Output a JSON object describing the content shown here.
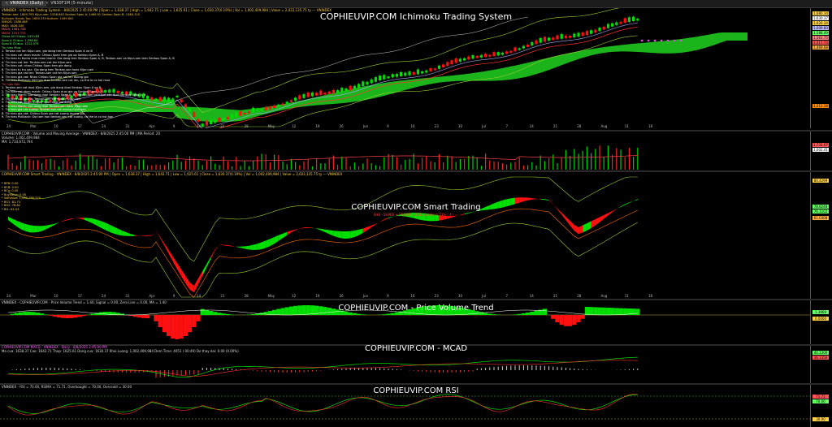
{
  "tabs": [
    {
      "label": "VNINDEX (Daily)",
      "active": true
    },
    {
      "label": "VN30F1M (5-minute)",
      "active": false
    }
  ],
  "dates": [
    "24",
    "Mar",
    "10",
    "17",
    "24",
    "31",
    "Apr",
    "9",
    "14",
    "21",
    "28",
    "May",
    "12",
    "19",
    "26",
    "Jun",
    "9",
    "16",
    "23",
    "30",
    "Jul",
    "7",
    "14",
    "21",
    "28",
    "Aug",
    "11",
    "18"
  ],
  "ichimoku": {
    "title": "COPHIEUVIP.COM Ichimoku Trading System",
    "header": "VNINDEX - Ichimoku Trading System - 8/8/2025 2:45:00 PM | Open = 1,638.37 | High = 1,642.71 | Low = 1,625.61 | Close = 1,630.37(0.19%) | Vol = 1,002,409,984 | Value = 2,022,135.75 ty --- VNINDEX",
    "info": [
      {
        "text": "Tenkan-sen: 1609.795  Kijun-sen: 1558.645  Senkou Span A: 1466.91  Senkou Span B: 1348.115",
        "color": "#ffd24a"
      },
      {
        "text": "Bollinger Bands Top: 1680.339  Bottom: 1469.681",
        "color": "#ffb040"
      },
      {
        "text": "SMA20: 1588.485",
        "color": "#ffd24a"
      },
      {
        "text": "MA5: 1626.335",
        "color": "#ffd24a"
      },
      {
        "text": "MA20: 1561.748",
        "color": "#ff8888"
      },
      {
        "text": "MA50: 1517.725",
        "color": "#ff6666"
      },
      {
        "text": "Cloud All Chikou: 1470.83",
        "color": "#66ff66"
      },
      {
        "text": "Span A Chikou: 1,398.64",
        "color": "#66ff66"
      },
      {
        "text": "Span B Chikou: 1212.375",
        "color": "#66ff66"
      },
      {
        "text": "Tin hieu Mua:",
        "color": "#66ff66"
      },
      {
        "text": "1. Tenkan cat len Kijun-sen, gia dong tren Senkou Span A va B",
        "color": "#ffffff"
      },
      {
        "text": "2. Tin hieu cat nhan manh: Chikou Span tren gia va Senkou Span A, B",
        "color": "#ffffff"
      },
      {
        "text": "3. Tin hieu tu Kumo mua nhan thanh: Gia dong tren Senkou Span A, B, Tenkan-sen va Kijun-sen tren Senkou Span A, B",
        "color": "#ffffff"
      },
      {
        "text": "4. Tin hieu cat len: Tenkan-sen cat len Kijun-sen",
        "color": "#ffffff"
      },
      {
        "text": "5. Tin hieu cat: nhan Chikou Span tren gia dong",
        "color": "#ffffff"
      },
      {
        "text": "6. Tin hieu tu tru xac: Gia dong tren Tenkan-sen hoac Kijun-sen",
        "color": "#ffffff"
      },
      {
        "text": "7. Tin hieu gia cat len: Tenkan-sen cat len Kijun-sen",
        "color": "#ffffff"
      },
      {
        "text": "8. Tin hieu gia vat: Nhan Chikou Span gia cat len duong gia",
        "color": "#ffffff"
      },
      {
        "text": "9. Tin hieu Pullback: Ket hon duoi tenkan-sen cat len, co the la co hoi mua",
        "color": "#ffffff"
      },
      {
        "text": "Tin hieu Ban:",
        "color": "#ff5555"
      },
      {
        "text": "1. Tenkan-sen cat duoi Kijun-sen, gia dong duoi Senkou Span A va B",
        "color": "#ffffff"
      },
      {
        "text": "2. Tin hieu cat nhan manh: Chikou Span duoi gia va Senkou Span A, B",
        "color": "#ffffff"
      },
      {
        "text": "3. Tin hieu Manh: Gia dong duoi Senkou Span A, B, Tenkan-sen va Kijun-sen duoi Senkou Span A, B",
        "color": "#ffffff"
      },
      {
        "text": "4. Tin hieu cat xuong: Tenkan-sen cat xuong Kijun-sen",
        "color": "#ffffff"
      },
      {
        "text": "5. Tin hieu cat: nhan Chikou Span duoi gia dong",
        "color": "#ffffff"
      },
      {
        "text": "6. Tin hieu Manh: Gia dong duoi Tenkan-sen hoac Kijun-sen",
        "color": "#ffffff"
      },
      {
        "text": "7. Tin hieu gia cat xuong: Tenkan-sen cat xuong Kijun-sen",
        "color": "#ffffff"
      },
      {
        "text": "8. Tin hieu gia vat: Chikou Span gia cat xuong duong gia",
        "color": "#ffffff"
      },
      {
        "text": "9. Tin hieu Pullback: Gia tam hon tenkan-sen cat xuong, co the la co hoi ban",
        "color": "#ffffff"
      }
    ],
    "axis_tags": [
      {
        "value": "1,680.34",
        "color": "#ffd24a"
      },
      {
        "value": "1,630.37",
        "color": "#ffffff"
      },
      {
        "value": "1,626.34",
        "color": "#ffd24a"
      },
      {
        "value": "1,609.80",
        "color": "#bbbbff"
      },
      {
        "value": "1,588.49",
        "color": "#66ff66"
      },
      {
        "value": "1,561.75",
        "color": "#ff8888"
      },
      {
        "value": "1,517.73",
        "color": "#ff5555"
      },
      {
        "value": "1,469.68",
        "color": "#ffb040"
      },
      {
        "value": "1,212.38",
        "color": "#ff8c00"
      }
    ]
  },
  "volume": {
    "header": "COPHIEUVIP.COM - Volume and Moving Average - VNINDEX - 8/8/2025 2:45:00 PM | MA Period: 20",
    "line2": "Volume: 1,002,409,984",
    "line3": "MA: 1,733,672,794",
    "axis_tags": [
      {
        "value": "1,733.67",
        "color": "#ff5555"
      },
      {
        "value": "1,002.41",
        "color": "#ffffff"
      }
    ]
  },
  "smart": {
    "title": "COPHIEUVIP.COM Smart Trading",
    "subtitle": "SHB - SUPER + PROFIT = 1.11 points: 0.23% ( 4 ) ---",
    "header": "COPHIEUVIP.COM Smart Trading - VNINDEX - 8/8/2025 2:45:00 PM | Open = 1,638.37 | High = 1,642.71 | Low = 1,625.61 | Close = 1,630.37(0.19%) | Vol = 1,002,409,984 | Value = 2,022,135.75 ty --- VNINDEX",
    "info": [
      {
        "text": "* BPB:    0.00",
        "color": "#ffd24a"
      },
      {
        "text": "* BCB:    0.00",
        "color": "#ffd24a"
      },
      {
        "text": "* BCa:    0.00",
        "color": "#ffd24a"
      },
      {
        "text": "* BuyValue:    0.00",
        "color": "#ffd24a"
      },
      {
        "text": "* SellValue: 1,630,786,570",
        "color": "#ffd24a"
      },
      {
        "text": "* BO1:    81.73",
        "color": "#ffd24a"
      },
      {
        "text": "* BO2:    78.82",
        "color": "#ffd24a"
      },
      {
        "text": "* BI1:    61.03",
        "color": "#ffd24a"
      }
    ],
    "axis_tags": [
      {
        "value": "80.4299",
        "color": "#ffd24a"
      },
      {
        "value": "78.8248",
        "color": "#66ff66"
      },
      {
        "value": "76.1102",
        "color": "#66ff66"
      },
      {
        "value": "61.0308",
        "color": "#ffb040"
      }
    ]
  },
  "pvt": {
    "title": "COPHIEUVIP.COM - Price Volume Trend",
    "header": "VNINDEX - COPHIEUVIP.COM - Price Volume Trend = 1.40, Signal = 0.00, Zero Line = 0.00, MA = 1.40",
    "axis_tags": [
      {
        "value": "1.3969",
        "color": "#66ff66"
      },
      {
        "value": "0.0000",
        "color": "#ffd24a"
      }
    ]
  },
  "macd": {
    "title": "COPHIEUVIP.COM - MCAD",
    "header": "COPHIEUVIP.COM MACD - VNINDEX - Daily - 8/8/2025 2:45:00 PM",
    "line2": "Mo cua: 1638.37  Cao: 1642.71  Thap: 1625.61  Dong cua: 1630.37  Khoi Luong: 1,002,409,984  Dem Time: 4051 ( 00:49)  Do thay doi: 0.00 (0.00%)",
    "axis_tags": [
      {
        "value": "40.1306",
        "color": "#66ff66"
      },
      {
        "value": "36.1356",
        "color": "#ff5555"
      }
    ]
  },
  "rsi": {
    "title": "COPHIEUVIP.COM RSI",
    "header": "VNINDEX - RSI = 70.00, RSIMA = 71.71, Overbought = 70.00, Oversold = 30.00",
    "axis_tags": [
      {
        "value": "71.71",
        "color": "#ff5555"
      },
      {
        "value": "70.00",
        "color": "#66ff66"
      },
      {
        "value": "30.00",
        "color": "#ffd24a"
      }
    ]
  },
  "colors": {
    "cloud": "#1ec81e",
    "bull": "#00e000",
    "bear": "#ff1010",
    "accent": "#ffd24a"
  }
}
